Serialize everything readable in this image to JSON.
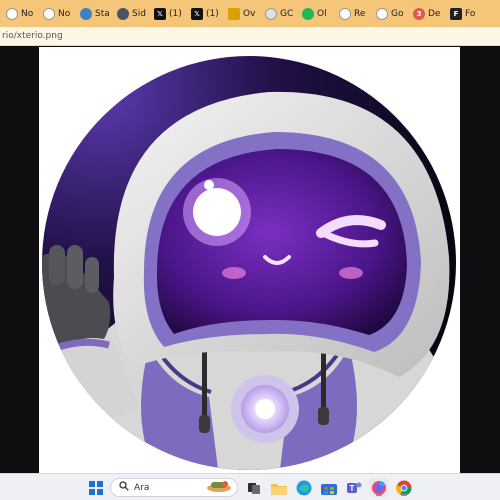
{
  "browser": {
    "accent": "#f5c67a",
    "tabs": [
      {
        "label": "No",
        "icon": "notion-icon",
        "color": "#ffffff"
      },
      {
        "label": "No",
        "icon": "notion-icon",
        "color": "#ffffff"
      },
      {
        "label": "Sta",
        "icon": "globe-icon",
        "color": "#3b82c4"
      },
      {
        "label": "Sid",
        "icon": "globe-icon",
        "color": "#4a5563"
      },
      {
        "label": "(1)",
        "icon": "x-icon",
        "color": "#111111"
      },
      {
        "label": "(1)",
        "icon": "x-icon",
        "color": "#111111"
      },
      {
        "label": "Ov",
        "icon": "ow-icon",
        "color": "#d9a100"
      },
      {
        "label": "GC",
        "icon": "fire-icon",
        "color": "#e0e0e0"
      },
      {
        "label": "Ol",
        "icon": "spotify-icon",
        "color": "#1db954"
      },
      {
        "label": "Re",
        "icon": "reddit-icon",
        "color": "#ffffff"
      },
      {
        "label": "Go",
        "icon": "google-icon",
        "color": "#ffffff"
      },
      {
        "label": "De",
        "icon": "dev-icon",
        "color": "#e0584e"
      },
      {
        "label": "Fo",
        "icon": "fo-icon",
        "color": "#222222"
      }
    ],
    "url": "rio/xterio.png"
  },
  "taskbar": {
    "search_placeholder": "Ara",
    "icons": [
      {
        "name": "windows-start-icon"
      },
      {
        "name": "search-icon"
      },
      {
        "name": "widgets-icon"
      },
      {
        "name": "task-view-icon"
      },
      {
        "name": "file-explorer-icon"
      },
      {
        "name": "edge-icon"
      },
      {
        "name": "store-icon"
      },
      {
        "name": "teams-icon"
      },
      {
        "name": "mail-icon"
      },
      {
        "name": "copilot-icon"
      },
      {
        "name": "chrome-icon"
      }
    ]
  },
  "colors": {
    "purple_dark": "#2a1150",
    "purple_mid": "#5d3aa6",
    "purple_light": "#8d79c6",
    "hood_grey": "#dcdcdc",
    "glow": "#f7e9ff"
  }
}
